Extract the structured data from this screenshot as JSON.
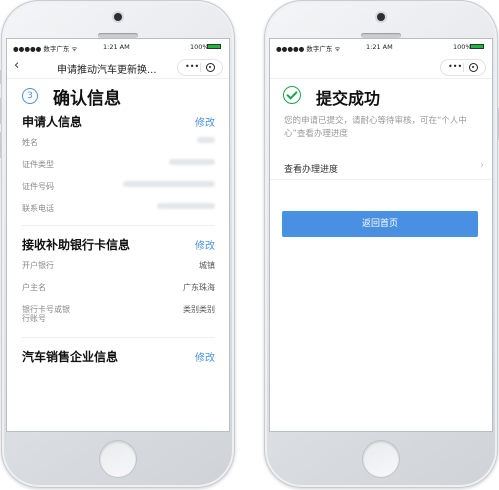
{
  "status_bar": {
    "carrier": "●●●●● 数字广东 ᯤ",
    "time": "1:21 AM",
    "battery_pct": "100%",
    "battery_level": 1.0,
    "battery_color": "#1db93a"
  },
  "left_screen": {
    "nav": {
      "back_icon": "chevron-left-icon",
      "title": "申请推动汽车更新换...",
      "capsule_dots": "•••"
    },
    "step": {
      "number": "3",
      "title": "确认信息"
    },
    "sections": [
      {
        "label": "申请人信息",
        "edit": "修改",
        "rows": [
          {
            "key": "姓名",
            "value": "",
            "redacted": true
          },
          {
            "key": "证件类型",
            "value": "",
            "redacted": true
          },
          {
            "key": "证件号码",
            "value": "",
            "redacted": true
          },
          {
            "key": "联系电话",
            "value": "",
            "redacted": true
          }
        ]
      },
      {
        "label": "接收补助银行卡信息",
        "edit": "修改",
        "rows": [
          {
            "key": "开户银行",
            "value": "城镇"
          },
          {
            "key": "户主名",
            "value": "广东珠海"
          },
          {
            "key": "银行卡号或银",
            "value": "类别类别"
          },
          {
            "key": "行账号",
            "value": ""
          }
        ]
      },
      {
        "label": "汽车销售企业信息",
        "edit": "修改",
        "rows": []
      }
    ]
  },
  "right_screen": {
    "nav": {
      "capsule_dots": "•••"
    },
    "success_title": "提交成功",
    "success_desc": "您的申请已提交，请耐心等待审核，可在“个人中心”查看办理进度",
    "progress_label": "查看办理进度",
    "progress_chevron": "›",
    "home_button": "返回首页",
    "accent_color": "#4a90e2",
    "success_color": "#1aa64a"
  }
}
